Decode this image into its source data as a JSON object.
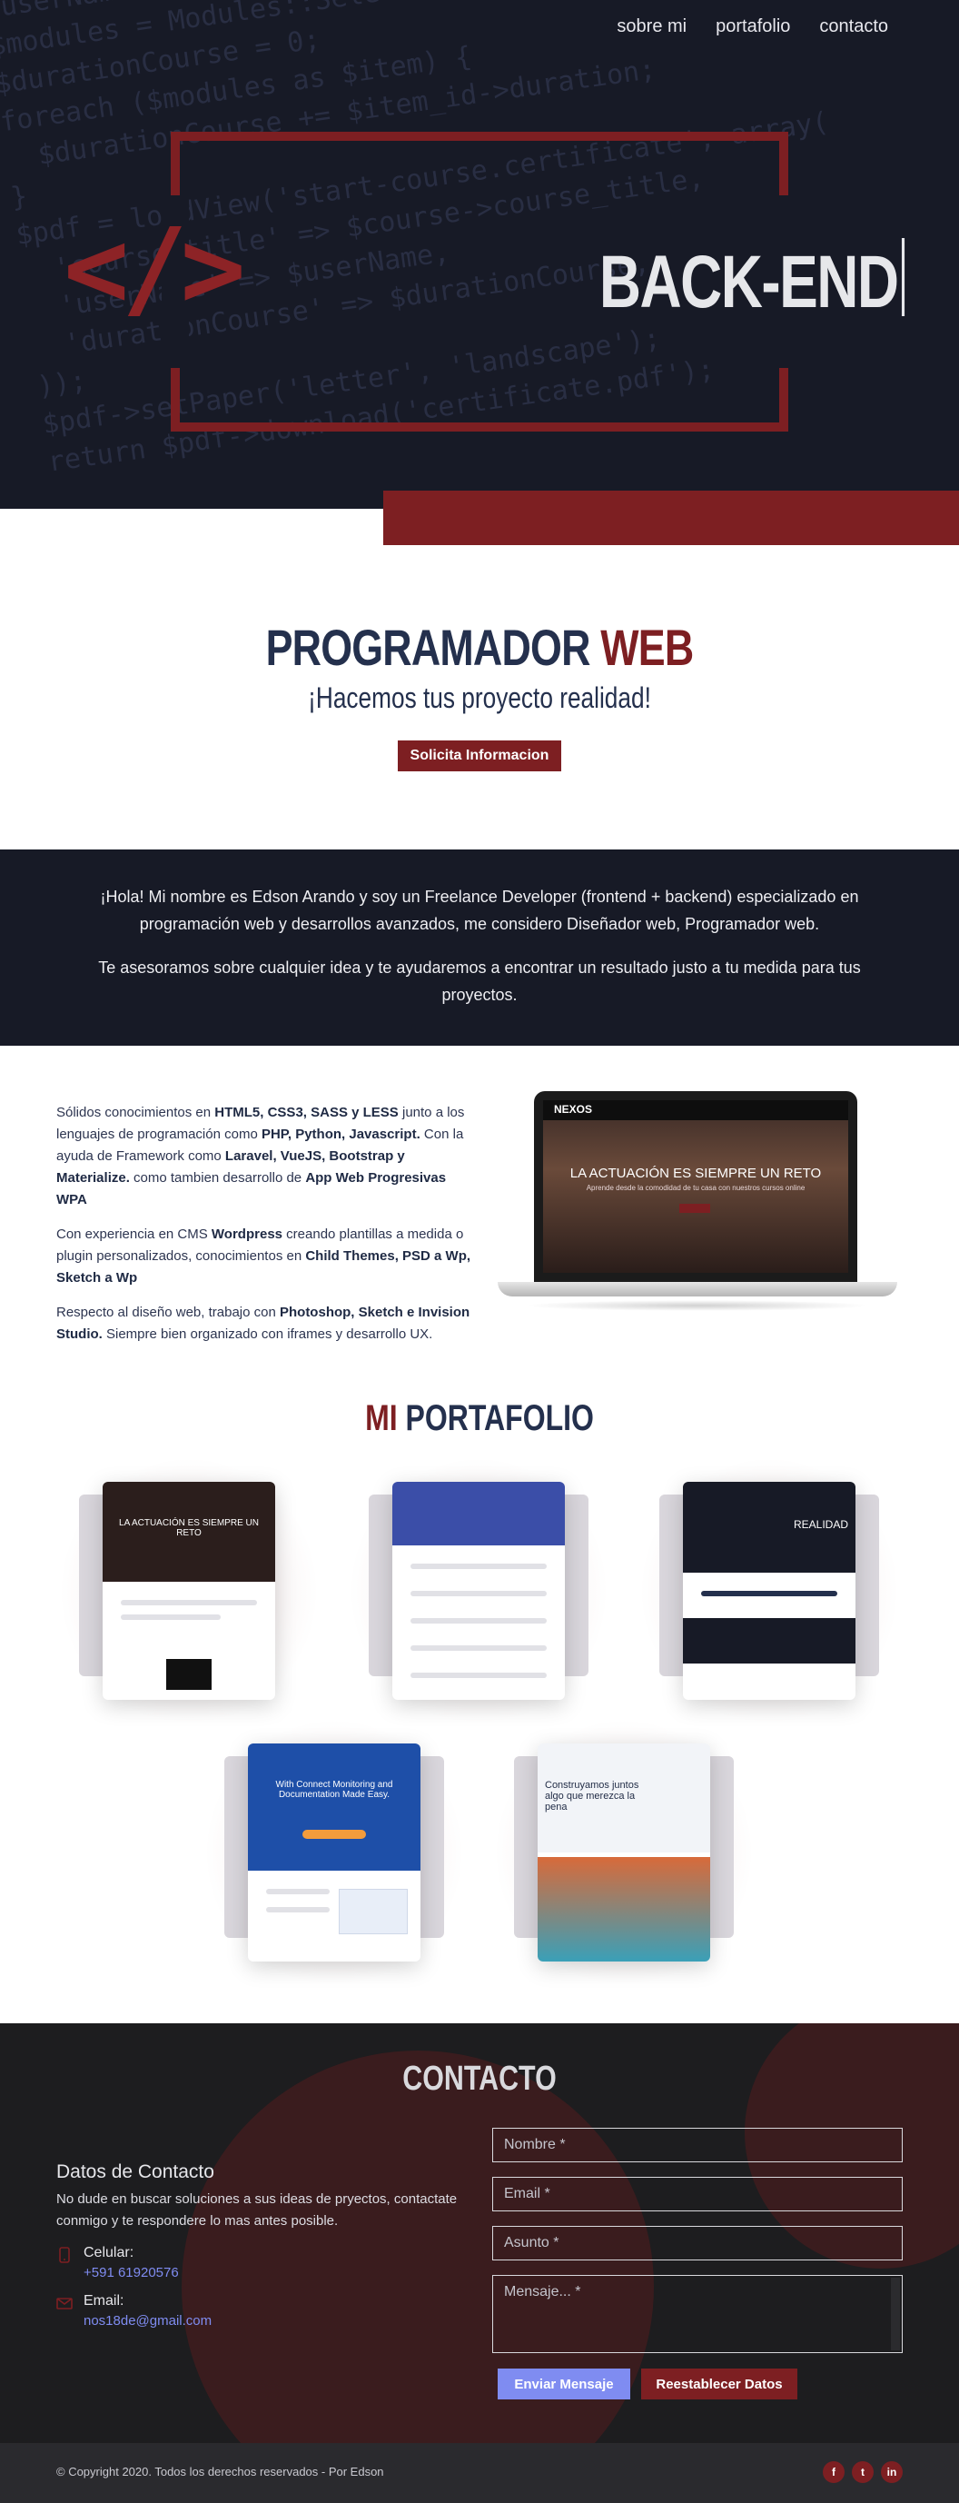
{
  "nav": {
    "items": [
      "sobre mi",
      "portafolio",
      "contacto"
    ]
  },
  "hero": {
    "logo": "</>",
    "title": "BACK-END",
    "code_bg": "$userName = $user->name;\n$modules = Modules::Select('duration')->where('course_id', $id)->get();\n$durationCourse = 0;\nforeach ($modules as $item) {\n  $durationCourse += $item_id->duration;\n}\n$pdf = loadView('start-course.certificate', array(\n  'course_title' => $course->course_title,\n  'userName' => $userName,\n  'durationCourse' => $durationCourse,\n));\n$pdf->setPaper('letter', 'landscape');\nreturn $pdf->download('certificate.pdf');"
  },
  "intro": {
    "title_main": "PROGRAMADOR",
    "title_accent": "WEB",
    "subtitle": "¡Hacemos tus proyecto realidad!",
    "button": "Solicita Informacion"
  },
  "about": {
    "p1": "¡Hola! Mi nombre es Edson Arando y soy un Freelance Developer (frontend + backend) especializado en programación web y desarrollos avanzados, me considero Diseñador web, Programador web.",
    "p2": "Te asesoramos sobre cualquier idea y te ayudaremos a encontrar un resultado justo a tu medida para tus proyectos."
  },
  "skills": {
    "p1_a": "Sólidos conocimientos en ",
    "p1_b": "HTML5, CSS3, SASS y LESS",
    "p1_c": " junto a los lenguajes de programación como ",
    "p1_d": "PHP, Python, Javascript.",
    "p1_e": " Con la ayuda de Framework como ",
    "p1_f": "Laravel, VueJS, Bootstrap y Materialize.",
    "p1_g": " como tambien desarrollo de ",
    "p1_h": "App Web Progresivas WPA",
    "p2_a": "Con experiencia en CMS ",
    "p2_b": "Wordpress",
    "p2_c": " creando plantillas a medida o plugin personalizados, conocimientos en ",
    "p2_d": "Child Themes, PSD a Wp, Sketch a Wp",
    "p3_a": "Respecto al diseño web, trabajo con ",
    "p3_b": "Photoshop, Sketch e Invision Studio.",
    "p3_c": " Siempre bien organizado con iframes y desarrollo UX.",
    "laptop": {
      "brand": "NEXOS",
      "headline": "LA ACTUACIÓN ES SIEMPRE UN RETO",
      "sub": "Aprende desde la comodidad de tu casa con nuestros cursos online"
    }
  },
  "portfolio": {
    "title_accent": "MI",
    "title_main": "PORTAFOLIO",
    "cards": [
      {
        "title": "LA ACTUACIÓN ES SIEMPRE UN RETO",
        "color": "#2b1e1c"
      },
      {
        "title": "",
        "color": "#3b4ea8"
      },
      {
        "title": "REALIDAD",
        "color": "#171a26"
      },
      {
        "title": "With Connect Monitoring and Documentation Made Easy.",
        "color": "#1e4fa8"
      },
      {
        "title": "Construyamos juntos algo que merezca la pena",
        "color": "#f2f4f8"
      }
    ]
  },
  "contact": {
    "title": "CONTACTO",
    "heading": "Datos de Contacto",
    "desc": "No dude en buscar soluciones a sus ideas de pryectos, contactate conmigo y te respondere lo mas antes posible.",
    "phone_label": "Celular:",
    "phone": "+591 61920576",
    "email_label": "Email:",
    "email": "nos18de@gmail.com",
    "form": {
      "name_ph": "Nombre *",
      "email_ph": "Email *",
      "subject_ph": "Asunto *",
      "message_ph": "Mensaje... *",
      "send": "Enviar Mensaje",
      "reset": "Reestablecer Datos"
    }
  },
  "footer": {
    "copy": "© Copyright 2020. Todos los derechos reservados - Por Edson",
    "social": [
      "f",
      "t",
      "in"
    ]
  },
  "colors": {
    "accent": "#7d1f22",
    "dark": "#171a26",
    "navy": "#24304d",
    "link": "#7f8cf1"
  }
}
